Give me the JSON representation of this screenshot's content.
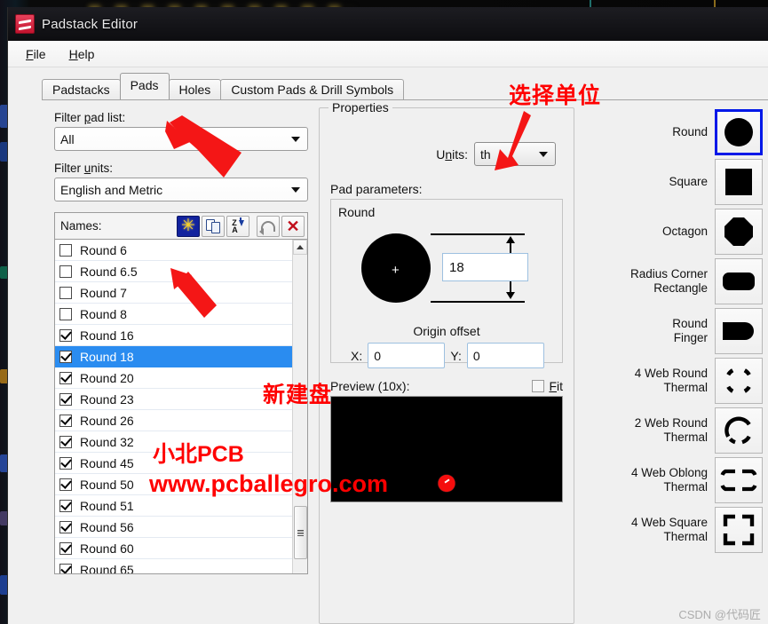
{
  "window": {
    "title": "Padstack Editor",
    "icon": "padstack-app-icon"
  },
  "menubar": {
    "items": [
      {
        "label": "File",
        "mnemonic": "F"
      },
      {
        "label": "Help",
        "mnemonic": "H"
      }
    ]
  },
  "tabs": [
    {
      "label": "Padstacks",
      "active": false
    },
    {
      "label": "Pads",
      "active": true
    },
    {
      "label": "Holes",
      "active": false
    },
    {
      "label": "Custom Pads & Drill Symbols",
      "active": false
    }
  ],
  "left_pane": {
    "filter_pad_list_label": "Filter pad list:",
    "filter_pad_list_value": "All",
    "filter_units_label": "Filter units:",
    "filter_units_value": "English and Metric",
    "names_label": "Names:",
    "toolbar": [
      {
        "name": "new-pad-button",
        "icon": "star-new-icon",
        "state": "active"
      },
      {
        "name": "copy-pad-button",
        "icon": "copy-icon",
        "state": "normal"
      },
      {
        "name": "sort-za-button",
        "icon": "sort-za-icon",
        "state": "normal"
      },
      {
        "name": "undo-button",
        "icon": "undo-icon",
        "state": "disabled"
      },
      {
        "name": "delete-button",
        "icon": "delete-x-icon",
        "state": "normal"
      }
    ],
    "pad_list": [
      {
        "label": "Round 6",
        "checked": false,
        "selected": false
      },
      {
        "label": "Round 6.5",
        "checked": false,
        "selected": false
      },
      {
        "label": "Round 7",
        "checked": false,
        "selected": false
      },
      {
        "label": "Round 8",
        "checked": false,
        "selected": false
      },
      {
        "label": "Round 16",
        "checked": true,
        "selected": false
      },
      {
        "label": "Round 18",
        "checked": true,
        "selected": true
      },
      {
        "label": "Round 20",
        "checked": true,
        "selected": false
      },
      {
        "label": "Round 23",
        "checked": true,
        "selected": false
      },
      {
        "label": "Round 26",
        "checked": true,
        "selected": false
      },
      {
        "label": "Round 32",
        "checked": true,
        "selected": false
      },
      {
        "label": "Round 45",
        "checked": true,
        "selected": false
      },
      {
        "label": "Round 50",
        "checked": true,
        "selected": false
      },
      {
        "label": "Round 51",
        "checked": true,
        "selected": false
      },
      {
        "label": "Round 56",
        "checked": true,
        "selected": false
      },
      {
        "label": "Round 60",
        "checked": true,
        "selected": false
      },
      {
        "label": "Round 65",
        "checked": true,
        "selected": false
      }
    ]
  },
  "properties": {
    "group_title": "Properties",
    "units_label": "Units:",
    "units_value": "th",
    "pad_parameters_label": "Pad parameters:",
    "shape_name": "Round",
    "diameter_value": "18",
    "origin_offset_label": "Origin offset",
    "x_label": "X:",
    "x_value": "0",
    "y_label": "Y:",
    "y_value": "0",
    "preview_label": "Preview (10x):",
    "fit_label": "Fit",
    "fit_checked": false
  },
  "palette": {
    "shapes": [
      {
        "label": "Round",
        "icon": "round-pad-icon",
        "selected": true
      },
      {
        "label": "Square",
        "icon": "square-pad-icon",
        "selected": false
      },
      {
        "label": "Octagon",
        "icon": "octagon-pad-icon",
        "selected": false
      },
      {
        "label": "Radius Corner\nRectangle",
        "icon": "radius-corner-rect-icon",
        "selected": false
      },
      {
        "label": "Round\nFinger",
        "icon": "round-finger-icon",
        "selected": false
      },
      {
        "label": "4 Web Round\nThermal",
        "icon": "4-web-round-thermal-icon",
        "selected": false
      },
      {
        "label": "2 Web Round\nThermal",
        "icon": "2-web-round-thermal-icon",
        "selected": false
      },
      {
        "label": "4 Web Oblong\nThermal",
        "icon": "4-web-oblong-thermal-icon",
        "selected": false
      },
      {
        "label": "4 Web Square\nThermal",
        "icon": "4-web-square-thermal-icon",
        "selected": false
      }
    ]
  },
  "annotations": {
    "units_note": "选择单位",
    "new_pad_note": "新建盘",
    "brand_note": "小北PCB",
    "url_note": "www.pcballegro.com",
    "watermark": "CSDN @代码匠",
    "color": "#ff0000"
  }
}
